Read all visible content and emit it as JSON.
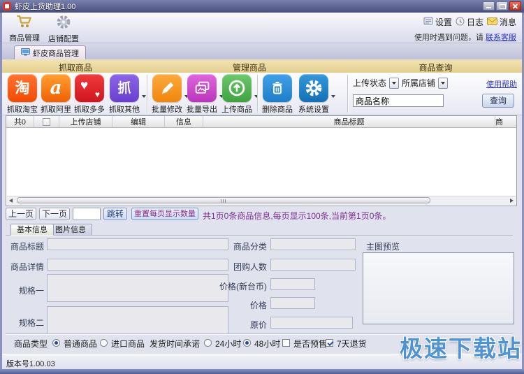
{
  "window": {
    "title": "虾皮上货助理1.00"
  },
  "toolbar": {
    "manage_label": "商品管理",
    "config_label": "店铺配置",
    "settings_label": "设置",
    "log_label": "日志",
    "message_label": "消息",
    "help_prefix": "使用时遇到问题，请",
    "help_link": "联系客服"
  },
  "main_tab": {
    "label": "虾皮商品管理"
  },
  "ribbon": {
    "group_grab": "抓取商品",
    "group_manage": "管理商品",
    "group_query": "商品查询",
    "buttons": [
      {
        "label": "抓取淘宝",
        "glyph": "淘"
      },
      {
        "label": "抓取阿里",
        "glyph": "a"
      },
      {
        "label": "抓取多多",
        "glyph": "♥"
      },
      {
        "label": "抓取其他",
        "glyph": "抓"
      },
      {
        "label": "批量修改"
      },
      {
        "label": "批量导出"
      },
      {
        "label": "上传商品"
      },
      {
        "label": "删除商品"
      },
      {
        "label": "系统设置"
      }
    ]
  },
  "query": {
    "status_label": "上传状态",
    "shop_label": "所属店铺",
    "help_link": "使用帮助",
    "name_value": "商品名称",
    "search_label": "查询"
  },
  "table": {
    "count_header": "共0",
    "headers": [
      "上传店铺",
      "编辑",
      "信息",
      "商品标题",
      "商"
    ]
  },
  "pager": {
    "prev": "上一页",
    "next": "下一页",
    "jump": "跳转",
    "reset": "重置每页显示数量",
    "info": "共1页0条商品信息,每页显示100条,当前第1页0条。"
  },
  "detail": {
    "tab_basic": "基本信息",
    "tab_image": "图片信息",
    "label_title": "商品标题",
    "label_detail": "商品详情",
    "label_spec1": "规格一",
    "label_spec2": "规格二",
    "label_category": "商品分类",
    "label_group_count": "团购人数",
    "label_price_twd": "价格(新台币)",
    "label_price": "价格",
    "label_orig_price": "原价",
    "preview_label": "主图预览",
    "label_type": "商品类型",
    "type_normal": "普通商品",
    "type_import": "进口商品",
    "label_delivery": "发货时间承诺",
    "delivery_24": "24小时",
    "delivery_48": "48小时",
    "presale": "是否预售",
    "return7": "7天退货"
  },
  "statusbar": {
    "version": "版本号1.00.03"
  },
  "watermark": {
    "text": "极速下载站"
  },
  "colors": {
    "taobao": "#ff5000",
    "alibaba": "#ff7a1e",
    "duoduo": "#e02525",
    "other_grab": "#7a52d8",
    "modify": "#f79420",
    "export": "#cc4ccc",
    "upload": "#4fb44f",
    "delete": "#2a8fd8",
    "system": "#1f86c8",
    "band": "#ecd9a2",
    "link": "#2b35c8",
    "pager_info": "#7b2e8e",
    "watermark": "#4f93d2"
  }
}
